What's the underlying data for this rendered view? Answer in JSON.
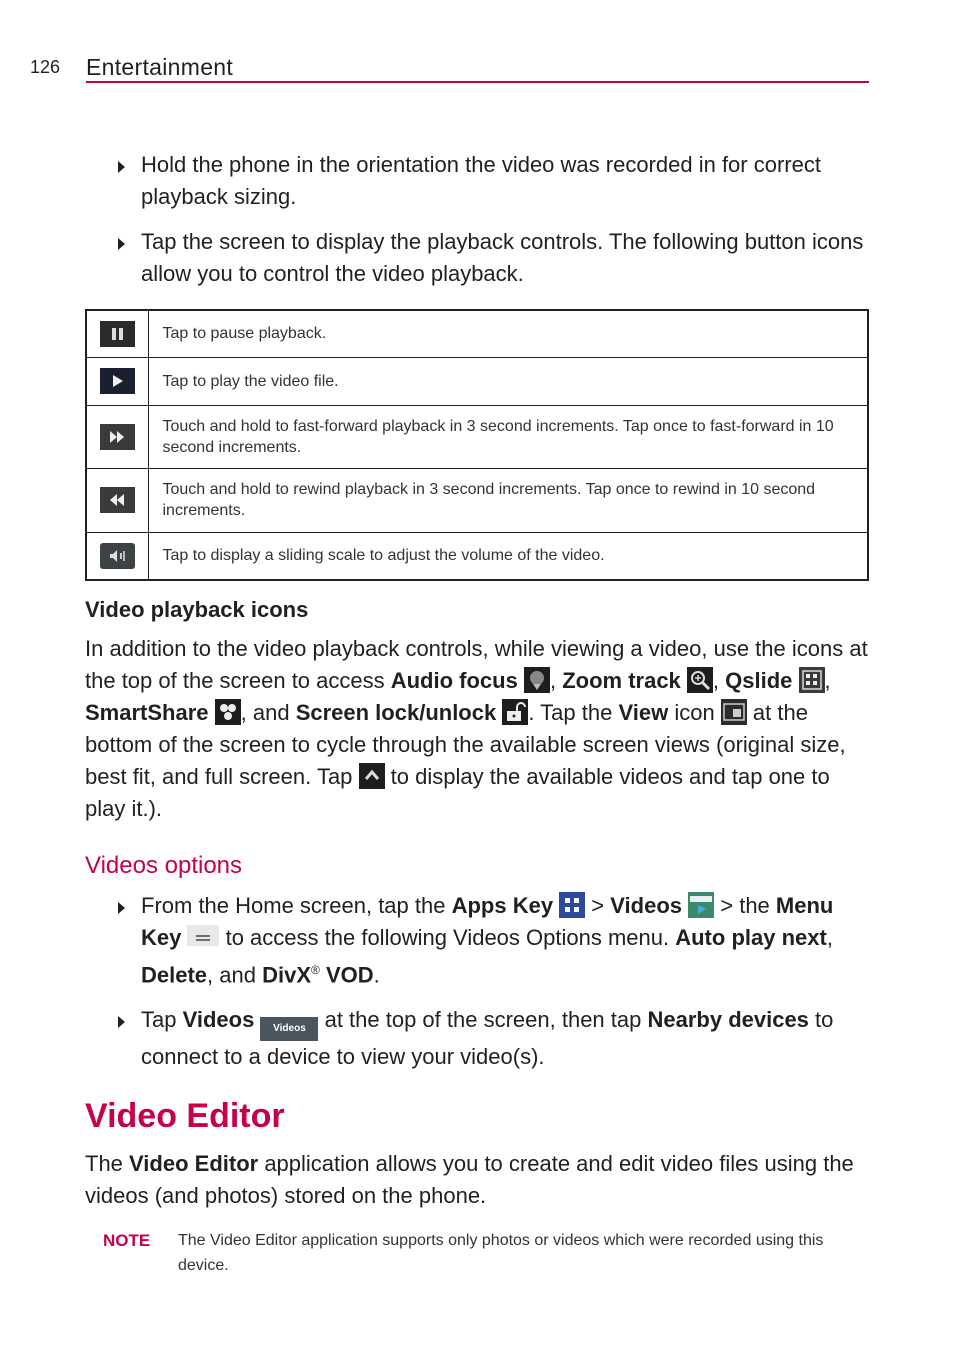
{
  "page": {
    "number": "126",
    "section": "Entertainment"
  },
  "intro_bullets": [
    "Hold the phone in the orientation the video was recorded in for correct playback sizing.",
    "Tap the screen to display the playback controls. The following button icons allow you to control the video playback."
  ],
  "controls_table": [
    {
      "icon": "pause-icon",
      "text": "Tap to pause playback."
    },
    {
      "icon": "play-icon",
      "text": "Tap to play the video file."
    },
    {
      "icon": "fast-forward-icon",
      "text": "Touch and hold to fast-forward playback in 3 second increments. Tap once to fast-forward in 10 second increments."
    },
    {
      "icon": "rewind-icon",
      "text": "Touch and hold to rewind playback in 3 second increments. Tap once to rewind in 10 second increments."
    },
    {
      "icon": "volume-icon",
      "text": "Tap to display a sliding scale to adjust the volume of the video."
    }
  ],
  "playback_icons": {
    "heading": "Video playback icons",
    "p1": "In addition to the video playback controls, while viewing a video, use the icons at the top of the screen to access ",
    "audio_focus": "Audio focus",
    "sep1": ", ",
    "zoom_track": "Zoom track",
    "sep2": ",",
    "qslide": "Qslide",
    "sep3": ", ",
    "smartshare": "SmartShare",
    "sep4": ", and ",
    "screen_lock": "Screen lock/unlock",
    "p2": ". Tap the ",
    "view": "View",
    "p3": " icon",
    "p4": " at the bottom of the screen to cycle through the available screen views (original size, best fit, and full screen. Tap ",
    "p5": " to display the available videos and tap one to play it.)."
  },
  "videos_options": {
    "heading": "Videos options",
    "b1_pre": "From the Home screen, tap the ",
    "apps_key": "Apps Key",
    "b1_gt1": " > ",
    "videos": "Videos",
    "b1_gt2": " > the ",
    "menu_key": "Menu Key",
    "b1_mid": " to access the following Videos Options menu. ",
    "auto_play": "Auto play next",
    "b1_c1": ", ",
    "delete": "Delete",
    "b1_c2": ", and ",
    "divx": "DivX",
    "reg": "®",
    "vod": " VOD",
    "b1_end": ".",
    "b2_pre": "Tap ",
    "b2_videos": "Videos",
    "videos_tab_label": "Videos",
    "b2_mid": " at the top of the screen, then tap ",
    "nearby": "Nearby devices",
    "b2_end": " to connect to a device to view your video(s)."
  },
  "video_editor": {
    "heading": "Video Editor",
    "p_pre": "The ",
    "p_bold": "Video Editor",
    "p_post": " application allows you to create and edit video files using the videos (and photos) stored on the phone.",
    "note_label": "NOTE",
    "note_text": "The Video Editor application supports only photos or videos which were recorded using this device."
  },
  "colors": {
    "accent": "#c4004f",
    "text": "#231f20"
  }
}
